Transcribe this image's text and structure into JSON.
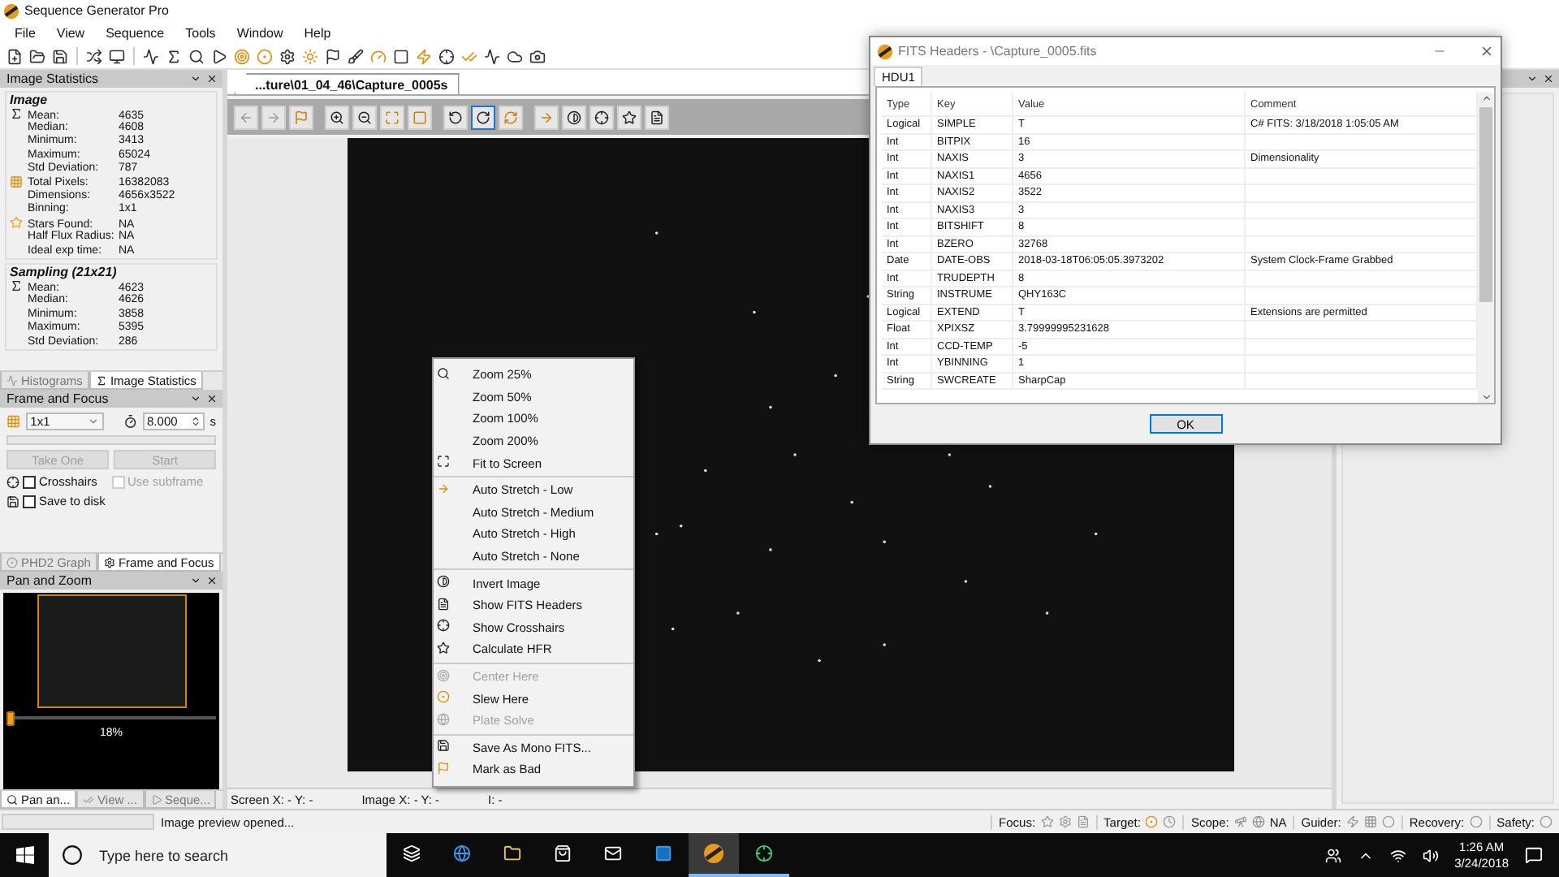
{
  "app_window": {
    "title": "Sequence Generator Pro"
  },
  "menu": [
    "File",
    "View",
    "Sequence",
    "Tools",
    "Window",
    "Help"
  ],
  "image_statistics": {
    "title": "Image Statistics",
    "sections": [
      {
        "title": "Image",
        "rows": [
          {
            "label": "Mean:",
            "value": "4635"
          },
          {
            "label": "Median:",
            "value": "4608"
          },
          {
            "label": "Minimum:",
            "value": "3413"
          },
          {
            "label": "Maximum:",
            "value": "65024"
          },
          {
            "label": "Std Deviation:",
            "value": "787"
          },
          {
            "label": "Total Pixels:",
            "value": "16382083"
          },
          {
            "label": "Dimensions:",
            "value": "4656x3522"
          },
          {
            "label": "Binning:",
            "value": "1x1"
          },
          {
            "label": "Stars Found:",
            "value": "NA"
          },
          {
            "label": "Half Flux Radius:",
            "value": "NA"
          },
          {
            "label": "Ideal exp time:",
            "value": "NA"
          }
        ]
      },
      {
        "title": "Sampling (21x21)",
        "rows": [
          {
            "label": "Mean:",
            "value": "4623"
          },
          {
            "label": "Median:",
            "value": "4626"
          },
          {
            "label": "Minimum:",
            "value": "3858"
          },
          {
            "label": "Maximum:",
            "value": "5395"
          },
          {
            "label": "Std Deviation:",
            "value": "286"
          }
        ]
      }
    ]
  },
  "top_tabs": [
    {
      "label": "Histograms",
      "selected": false
    },
    {
      "label": "Image Statistics",
      "selected": true
    }
  ],
  "frame_and_focus": {
    "title": "Frame and Focus",
    "binning": "1x1",
    "exposure": "8.000",
    "unit": "s",
    "progress": {
      "level": 0
    },
    "buttons": [
      {
        "label": "Take One",
        "disabled": true
      },
      {
        "label": "Start",
        "disabled": true
      }
    ],
    "options": [
      {
        "label": "Crosshairs",
        "checked": false,
        "disabled": false
      },
      {
        "label": "Use subframe",
        "checked": false,
        "disabled": true
      },
      {
        "label": "Save to disk",
        "checked": false,
        "disabled": false
      }
    ]
  },
  "middle_tabs": [
    {
      "label": "PHD2 Graph",
      "selected": false
    },
    {
      "label": "Frame and Focus",
      "selected": true
    }
  ],
  "pan_and_zoom": {
    "title": "Pan and Zoom",
    "zoom": {
      "level": 0
    },
    "reading": "18%"
  },
  "bottom_tabs": [
    {
      "label": "Pan an...",
      "selected": true
    },
    {
      "label": "View ...",
      "selected": false
    },
    {
      "label": "Seque...",
      "selected": false
    }
  ],
  "document_tab": {
    "label": "...ture\\01_04_46\\Capture_0005s",
    "selected": true
  },
  "image_toolbar": [
    {
      "selected": false,
      "disabled": true
    },
    {
      "selected": false,
      "disabled": true
    },
    {
      "selected": false,
      "disabled": false
    },
    {
      "selected": false,
      "disabled": false
    },
    {
      "selected": false,
      "disabled": false
    },
    {
      "selected": false,
      "disabled": false
    },
    {
      "selected": false,
      "disabled": false
    },
    {
      "selected": false,
      "disabled": false
    },
    {
      "selected": true,
      "disabled": false
    },
    {
      "selected": false,
      "disabled": false
    },
    {
      "selected": false,
      "disabled": false
    },
    {
      "selected": false,
      "disabled": false
    },
    {
      "selected": false,
      "disabled": false
    },
    {
      "selected": false,
      "disabled": false
    },
    {
      "selected": false,
      "disabled": false
    }
  ],
  "coordinates": [
    "Screen X: - Y: -",
    "Image X: - Y: -",
    "I: -"
  ],
  "context_menu": {
    "groups": [
      {
        "items": [
          {
            "label": "Zoom 25%",
            "disabled": false
          },
          {
            "label": "Zoom 50%",
            "disabled": false
          },
          {
            "label": "Zoom 100%",
            "disabled": false
          },
          {
            "label": "Zoom 200%",
            "disabled": false
          },
          {
            "label": "Fit to Screen",
            "disabled": false
          }
        ]
      },
      {
        "items": [
          {
            "label": "Auto Stretch - Low",
            "disabled": false
          },
          {
            "label": "Auto Stretch - Medium",
            "disabled": false
          },
          {
            "label": "Auto Stretch - High",
            "disabled": false
          },
          {
            "label": "Auto Stretch - None",
            "disabled": false
          }
        ]
      },
      {
        "items": [
          {
            "label": "Invert Image",
            "disabled": false
          },
          {
            "label": "Show FITS Headers",
            "disabled": false
          },
          {
            "label": "Show Crosshairs",
            "disabled": false
          },
          {
            "label": "Calculate HFR",
            "disabled": false
          }
        ]
      },
      {
        "items": [
          {
            "label": "Center Here",
            "disabled": true
          },
          {
            "label": "Slew Here",
            "disabled": false
          },
          {
            "label": "Plate Solve",
            "disabled": true
          }
        ]
      },
      {
        "items": [
          {
            "label": "Save As Mono FITS...",
            "disabled": false
          },
          {
            "label": "Mark as Bad",
            "disabled": false
          }
        ]
      }
    ]
  },
  "status_bar": {
    "message": "Image preview opened...",
    "progress": {
      "level": 0
    },
    "indicators": [
      {
        "label": "Focus:"
      },
      {
        "label": "Target:"
      },
      {
        "label": "Scope:",
        "value": "NA"
      },
      {
        "label": "Guider:"
      },
      {
        "label": "Recovery:"
      },
      {
        "label": "Safety:"
      }
    ]
  },
  "fits_dialog": {
    "title": "FITS Headers - \\Capture_0005.fits",
    "tabs": [
      {
        "label": "HDU1",
        "selected": true
      }
    ],
    "columns": [
      "Type",
      "Key",
      "Value",
      "Comment"
    ],
    "rows": [
      [
        "Logical",
        "SIMPLE",
        "T",
        "C# FITS: 3/18/2018 1:05:05 AM"
      ],
      [
        "Int",
        "BITPIX",
        "16",
        ""
      ],
      [
        "Int",
        "NAXIS",
        "3",
        "Dimensionality"
      ],
      [
        "Int",
        "NAXIS1",
        "4656",
        ""
      ],
      [
        "Int",
        "NAXIS2",
        "3522",
        ""
      ],
      [
        "Int",
        "NAXIS3",
        "3",
        ""
      ],
      [
        "Int",
        "BITSHIFT",
        "8",
        ""
      ],
      [
        "Int",
        "BZERO",
        "32768",
        ""
      ],
      [
        "Date",
        "DATE-OBS",
        "2018-03-18T06:05:05.3973202",
        "System Clock-Frame Grabbed"
      ],
      [
        "Int",
        "TRUDEPTH",
        "8",
        ""
      ],
      [
        "String",
        "INSTRUME",
        "QHY163C",
        ""
      ],
      [
        "Logical",
        "EXTEND",
        "T",
        "Extensions are permitted"
      ],
      [
        "Float",
        "XPIXSZ",
        "3.79999995231628",
        ""
      ],
      [
        "Int",
        "CCD-TEMP",
        "-5",
        ""
      ],
      [
        "Int",
        "YBINNING",
        "1",
        ""
      ],
      [
        "String",
        "SWCREATE",
        "SharpCap",
        ""
      ]
    ],
    "ok": "OK"
  },
  "taskbar": {
    "search": {
      "placeholder": "Type here to search"
    },
    "time": "1:26 AM",
    "date": "3/24/2018"
  }
}
